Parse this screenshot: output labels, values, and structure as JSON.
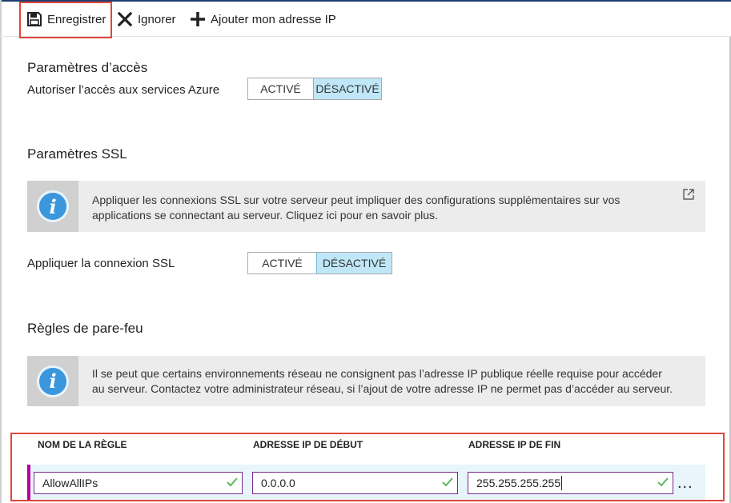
{
  "toolbar": {
    "save_label": "Enregistrer",
    "discard_label": "Ignorer",
    "add_ip_label": "Ajouter mon adresse IP"
  },
  "access": {
    "title": "Paramètres d’accès",
    "allow_azure_label": "Autoriser l’accès aux services Azure",
    "toggle": {
      "on_label": "ACTIVÉ",
      "off_label": "DÉSACTIVÉ",
      "selected": "DÉSACTIVÉ"
    }
  },
  "ssl": {
    "title": "Paramètres SSL",
    "info_line1": "Appliquer les connexions SSL sur votre serveur peut impliquer des configurations supplémentaires sur vos",
    "info_line2": "applications se connectant au serveur. Cliquez ici pour en savoir plus.",
    "enforce_label": "Appliquer la connexion SSL",
    "toggle": {
      "on_label": "ACTIVÉ",
      "off_label": "DÉSACTIVÉ",
      "selected": "DÉSACTIVÉ"
    }
  },
  "firewall": {
    "title": "Règles de pare-feu",
    "info_line1": "Il se peut que certains environnements réseau ne consignent pas l’adresse IP publique réelle requise pour accéder",
    "info_line2": "au serveur. Contactez votre administrateur réseau, si l’ajout de votre adresse IP ne permet pas d’accéder au serveur.",
    "columns": [
      "NOM DE LA RÈGLE",
      "ADRESSE IP DE DÉBUT",
      "ADRESSE IP DE FIN"
    ],
    "rows": [
      {
        "rule_name": "AllowAllIPs",
        "start_ip": "0.0.0.0",
        "end_ip": "255.255.255.255"
      }
    ],
    "more_label": "..."
  },
  "colors": {
    "highlight": "#e0473b",
    "toggle_selected": "#bfe7f7",
    "info_icon": "#3a96dd",
    "check": "#5cb85c",
    "row_marker": "#b4009e"
  },
  "icons": {
    "save": "save-icon",
    "discard": "close-icon",
    "add": "plus-icon",
    "info": "info-icon",
    "external": "external-link-icon",
    "valid": "checkmark-icon"
  }
}
